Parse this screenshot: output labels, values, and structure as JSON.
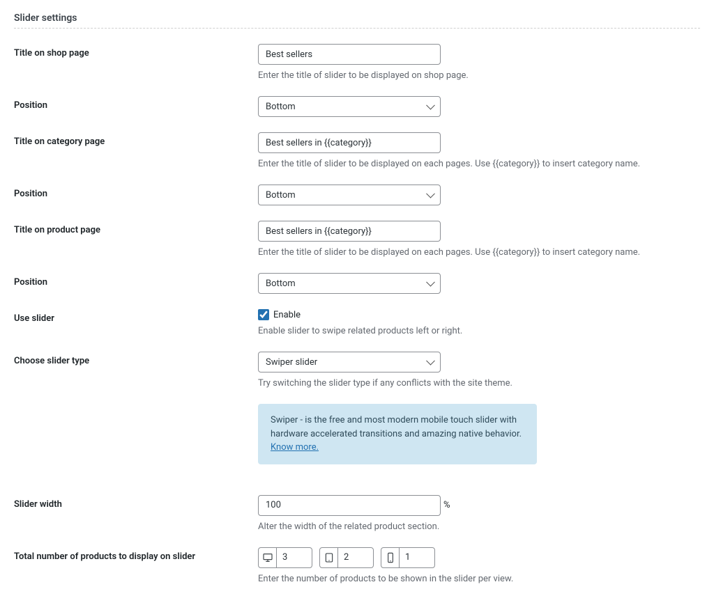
{
  "section_title": "Slider settings",
  "fields": {
    "title_shop": {
      "label": "Title on shop page",
      "value": "Best sellers",
      "description": "Enter the title of slider to be displayed on shop page."
    },
    "position1": {
      "label": "Position",
      "value": "Bottom"
    },
    "title_category": {
      "label": "Title on category page",
      "value": "Best sellers in {{category}}",
      "description": "Enter the title of slider to be displayed on each pages. Use {{category}} to insert category name."
    },
    "position2": {
      "label": "Position",
      "value": "Bottom"
    },
    "title_product": {
      "label": "Title on product page",
      "value": "Best sellers in {{category}}",
      "description": "Enter the title of slider to be displayed on each pages. Use {{category}} to insert category name."
    },
    "position3": {
      "label": "Position",
      "value": "Bottom"
    },
    "use_slider": {
      "label": "Use slider",
      "checkbox_label": "Enable",
      "checked": true,
      "description": "Enable slider to swipe related products left or right."
    },
    "slider_type": {
      "label": "Choose slider type",
      "value": "Swiper slider",
      "description": "Try switching the slider type if any conflicts with the site theme."
    },
    "info_box": {
      "text": "Swiper - is the free and most modern mobile touch slider with hardware accelerated transitions and amazing native behavior. ",
      "link_text": "Know more."
    },
    "slider_width": {
      "label": "Slider width",
      "value": "100",
      "unit": "%",
      "description": "Alter the width of the related product section."
    },
    "products_count": {
      "label": "Total number of products to display on slider",
      "desktop": "3",
      "tablet": "2",
      "mobile": "1",
      "description": "Enter the number of products to be shown in the slider per view."
    }
  }
}
